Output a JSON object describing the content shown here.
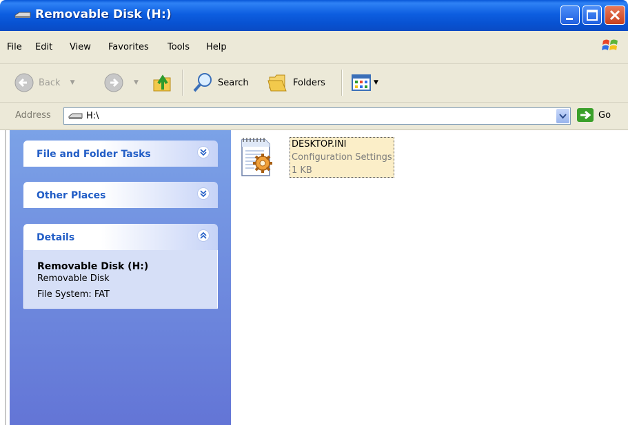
{
  "window": {
    "title": "Removable Disk (H:)",
    "title_icon": "removable-disk-icon"
  },
  "menu": [
    "File",
    "Edit",
    "View",
    "Favorites",
    "Tools",
    "Help"
  ],
  "toolbar": {
    "back_label": "Back",
    "search_label": "Search",
    "folders_label": "Folders"
  },
  "address": {
    "label": "Address",
    "value": "H:\\",
    "go_label": "Go"
  },
  "left_pane": {
    "file_tasks_title": "File and Folder Tasks",
    "other_places_title": "Other Places",
    "details_title": "Details",
    "details": {
      "name": "Removable Disk (H:)",
      "type": "Removable Disk",
      "file_system": "File System: FAT"
    }
  },
  "files": [
    {
      "name": "DESKTOP.INI",
      "type": "Configuration Settings",
      "size": "1 KB",
      "icon": "config-file-icon"
    }
  ],
  "colors": {
    "title_bar": "#0a58d8",
    "left_pane": "#7ba2e7",
    "panel_title": "#215dc6",
    "selection": "#fbeec8"
  }
}
